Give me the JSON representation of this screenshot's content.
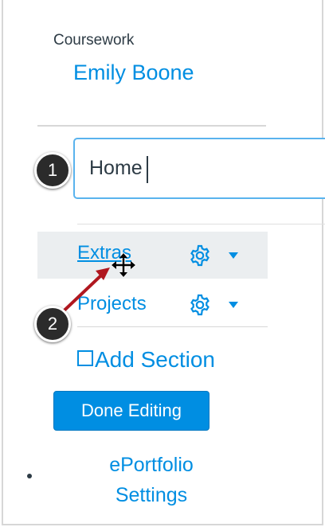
{
  "sidebar": {
    "heading": "Coursework",
    "user_name": "Emily Boone"
  },
  "new_section_input": {
    "value": "Home"
  },
  "sections": [
    {
      "label": "Extras"
    },
    {
      "label": "Projects"
    }
  ],
  "actions": {
    "add_section_label": "Add Section",
    "done_editing_label": "Done Editing",
    "eportfolio_settings_line1": "ePortfolio",
    "eportfolio_settings_line2": "Settings"
  },
  "annotations": {
    "step_1": "1",
    "step_2": "2"
  },
  "icons": {
    "gear": "gear-icon",
    "dropdown": "caret-down-icon",
    "checkbox": "square-icon",
    "cursor": "move-cursor-icon"
  },
  "colors": {
    "link": "#008ee2",
    "button_bg": "#008ee2",
    "active_row_bg": "#ebeef0",
    "input_border": "#59b3ee",
    "annotation_arrow": "#b0171f"
  }
}
